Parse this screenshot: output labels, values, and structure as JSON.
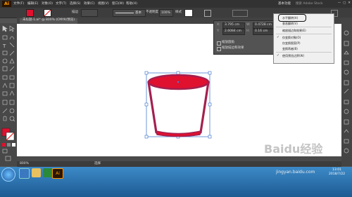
{
  "app": {
    "logo": "Ai"
  },
  "menubar": {
    "items": [
      "文件(F)",
      "编辑(E)",
      "对象(O)",
      "文字(T)",
      "选择(S)",
      "效果(C)",
      "视图(V)",
      "窗口(W)",
      "帮助(H)"
    ],
    "workspace": "基本功能",
    "search_placeholder": "搜索 Adobe Stock"
  },
  "control_bar": {
    "stroke_label": "描边",
    "stroke_style": "基本",
    "opacity_label": "不透明度",
    "opacity_value": "100%",
    "style_label": "样式"
  },
  "document": {
    "tab_title": "未标题-1.ai* @ 800% (CMYK/预览)"
  },
  "status": {
    "zoom": "800%",
    "tool": "选择"
  },
  "transform_panel": {
    "x": "3.795 cm",
    "y": "2.6084 cm",
    "w": "0.4728 cm",
    "h": "0.16 cm",
    "scale_corners": "缩放圆角",
    "scale_strokes": "缩放描边和效果"
  },
  "flyout_menu": {
    "items": [
      {
        "label": "水平翻转(H)",
        "checked": false,
        "highlight": true
      },
      {
        "label": "垂直翻转(V)",
        "checked": false
      },
      {
        "label": "缩放描边和效果(E)",
        "checked": false
      },
      {
        "label": "仅变换对象(O)",
        "checked": true
      },
      {
        "label": "仅变换图案(P)",
        "checked": false
      },
      {
        "label": "变换两者(B)",
        "checked": false
      },
      {
        "label": "使用预览边界(W)",
        "checked": true
      }
    ]
  },
  "taskbar": {
    "time": "13:01",
    "date": "2018/7/22"
  },
  "watermark": {
    "text": "Baidu经验",
    "site": "jingyan.baidu.com"
  },
  "colors": {
    "fill": "#e0102f",
    "stroke": "#a3204f",
    "selection": "#4a7ecf"
  }
}
